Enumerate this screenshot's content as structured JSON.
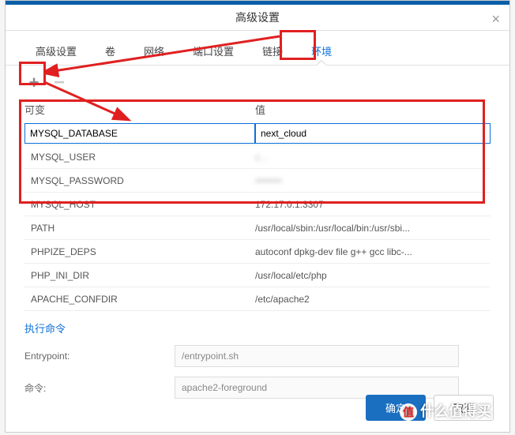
{
  "dialog": {
    "title": "高级设置",
    "close_glyph": "×"
  },
  "tabs": {
    "t0": "高级设置",
    "t1": "卷",
    "t2": "网络",
    "t3": "端口设置",
    "t4": "链接",
    "t5": "环境"
  },
  "toolbar": {
    "add_glyph": "+",
    "remove_glyph": "−"
  },
  "grid": {
    "head_var": "可变",
    "head_val": "值",
    "rows": [
      {
        "k": "MYSQL_DATABASE",
        "v": "next_cloud",
        "editing": true
      },
      {
        "k": "MYSQL_USER",
        "v": "c…",
        "blur": true
      },
      {
        "k": "MYSQL_PASSWORD",
        "v": "••••••••",
        "blur": true
      },
      {
        "k": "MYSQL_HOST",
        "v": "172.17.0.1:3307"
      },
      {
        "k": "PATH",
        "v": "/usr/local/sbin:/usr/local/bin:/usr/sbi..."
      },
      {
        "k": "PHPIZE_DEPS",
        "v": "autoconf dpkg-dev file g++ gcc libc-..."
      },
      {
        "k": "PHP_INI_DIR",
        "v": "/usr/local/etc/php"
      },
      {
        "k": "APACHE_CONFDIR",
        "v": "/etc/apache2"
      }
    ]
  },
  "exec": {
    "section": "执行命令",
    "entrypoint_label": "Entrypoint:",
    "entrypoint_value": "/entrypoint.sh",
    "cmd_label": "命令:",
    "cmd_value": "apache2-foreground"
  },
  "footer": {
    "ok": "确定",
    "cancel": "取消"
  },
  "watermark": "什么值得买"
}
